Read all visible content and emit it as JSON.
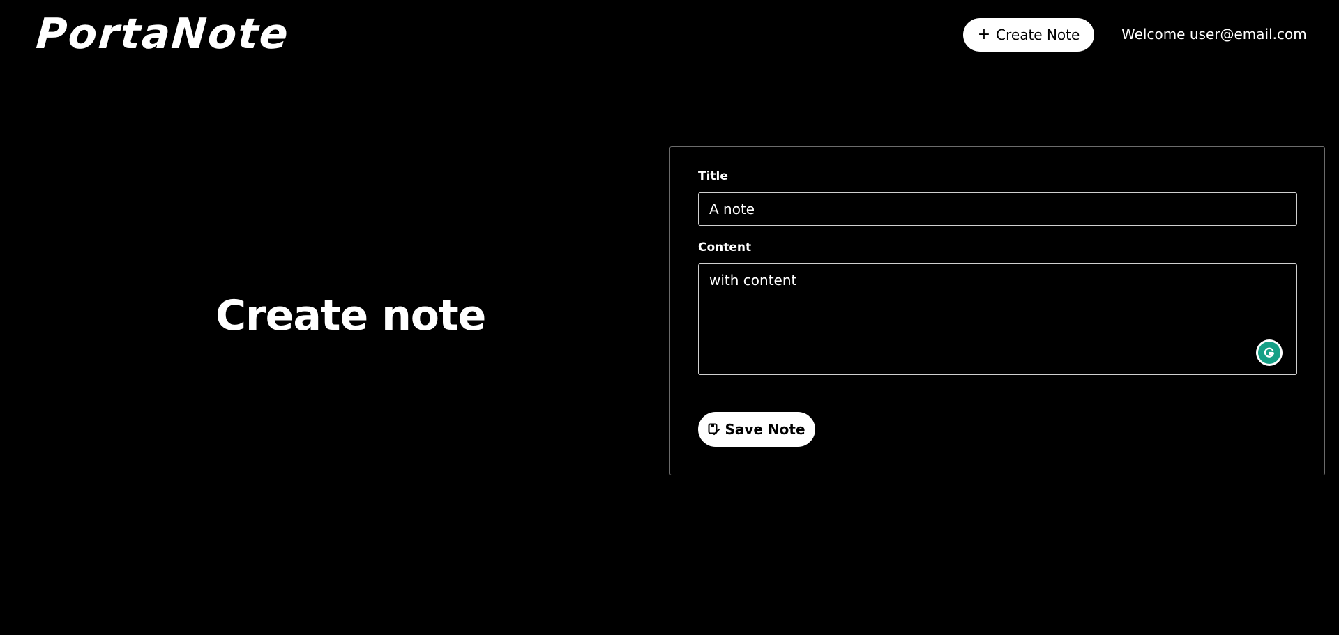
{
  "header": {
    "logo": "PortaNote",
    "create_button_icon": "+",
    "create_button_label": "Create Note",
    "welcome_text": "Welcome user@email.com"
  },
  "main": {
    "heading": "Create note"
  },
  "form": {
    "title_label": "Title",
    "title_value": "A note",
    "content_label": "Content",
    "content_value": "with content",
    "save_button_label": "Save Note",
    "save_icon": "save-edit-icon",
    "grammarly_icon": "grammarly-icon"
  },
  "colors": {
    "background": "#000000",
    "text": "#ffffff",
    "button_bg": "#ffffff",
    "button_text": "#000000",
    "grammarly_green": "#15a086"
  }
}
